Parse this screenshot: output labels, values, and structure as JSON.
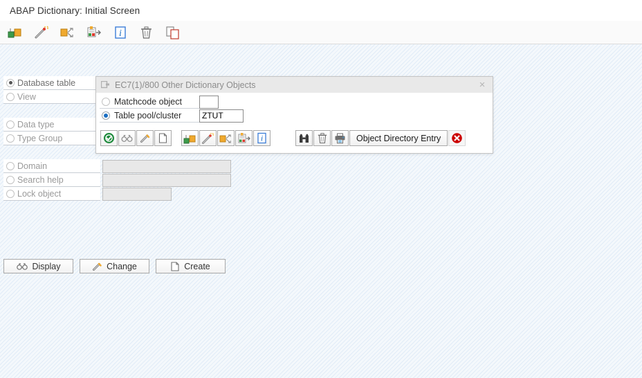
{
  "window": {
    "title": "ABAP Dictionary: Initial Screen"
  },
  "toolbar": {
    "buttons": [
      {
        "name": "open-object-icon",
        "label": "Other object"
      },
      {
        "name": "wand-icon",
        "label": "Create"
      },
      {
        "name": "where-used-icon",
        "label": "Where-used list"
      },
      {
        "name": "activate-icon",
        "label": "Activate"
      },
      {
        "name": "info-icon",
        "label": "Information"
      },
      {
        "name": "delete-icon",
        "label": "Delete"
      },
      {
        "name": "copy-icon",
        "label": "Copy"
      }
    ]
  },
  "form": {
    "options": [
      {
        "label": "Database table",
        "selected": true,
        "has_field": false
      },
      {
        "label": "View",
        "selected": false,
        "has_field": false
      },
      {
        "label": "Data type",
        "selected": false,
        "has_field": false
      },
      {
        "label": "Type Group",
        "selected": false,
        "has_field": false
      },
      {
        "label": "Domain",
        "selected": false,
        "has_field": true,
        "field_value": "",
        "field_width": 186
      },
      {
        "label": "Search help",
        "selected": false,
        "has_field": true,
        "field_value": "",
        "field_width": 186
      },
      {
        "label": "Lock object",
        "selected": false,
        "has_field": true,
        "field_value": "",
        "field_width": 100
      }
    ]
  },
  "actions": [
    {
      "label": "Display",
      "icon": "binoculars-icon"
    },
    {
      "label": "Change",
      "icon": "pencil-icon"
    },
    {
      "label": "Create",
      "icon": "page-icon"
    }
  ],
  "dialog": {
    "title": "EC7(1)/800 Other Dictionary Objects",
    "close_label": "×",
    "options": [
      {
        "label": "Matchcode object",
        "selected": false,
        "value": "",
        "field_width": 28
      },
      {
        "label": "Table pool/cluster",
        "selected": true,
        "value": "ZTUT",
        "field_width": 64
      }
    ],
    "buttons_left": [
      {
        "name": "confirm-icon",
        "label": "Continue"
      },
      {
        "name": "binoculars-icon",
        "label": "Display"
      },
      {
        "name": "pencil-icon",
        "label": "Change"
      },
      {
        "name": "page-icon",
        "label": "Create"
      }
    ],
    "buttons_mid": [
      {
        "name": "open-object-icon",
        "label": "Other object"
      },
      {
        "name": "wand-icon",
        "label": "Create"
      },
      {
        "name": "where-used-icon",
        "label": "Where-used list"
      },
      {
        "name": "activate-icon",
        "label": "Activate"
      },
      {
        "name": "info-icon",
        "label": "Information"
      }
    ],
    "buttons_right": [
      {
        "name": "binoculars-dark-icon",
        "label": "Find"
      },
      {
        "name": "trash-icon",
        "label": "Delete"
      },
      {
        "name": "printer-icon",
        "label": "Print"
      }
    ],
    "object_directory_label": "Object Directory Entry",
    "cancel_label": "Cancel"
  },
  "colors": {
    "accent_blue": "#1b6ec2",
    "cancel_red": "#cc0000",
    "confirm_green": "#1e8a3c",
    "background": "#f4f8fc"
  }
}
